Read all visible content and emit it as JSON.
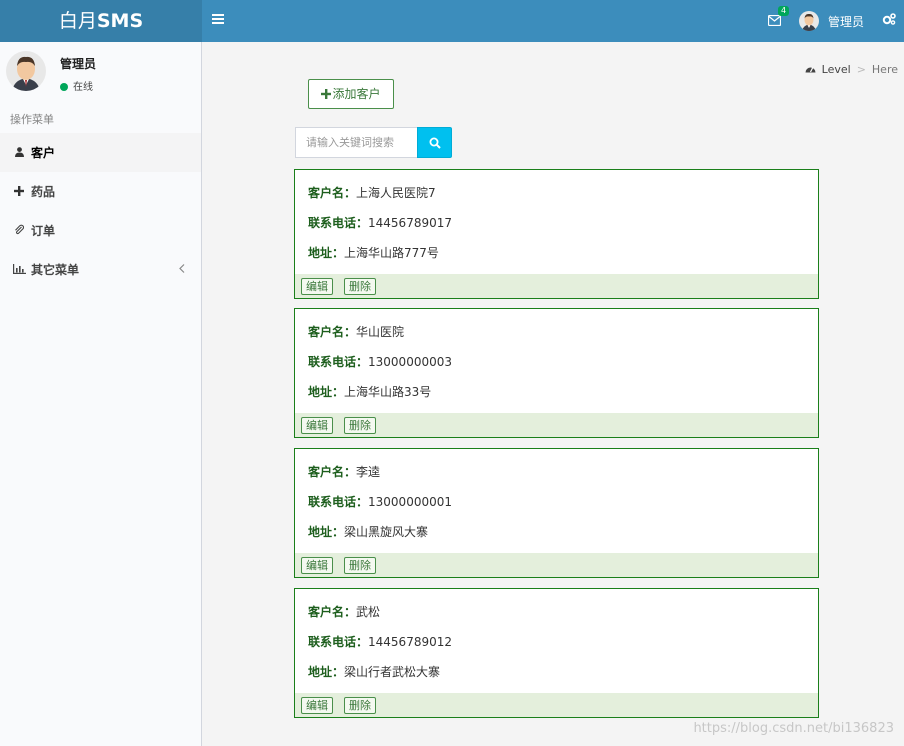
{
  "header": {
    "logo_light": "白月",
    "logo_bold": "SMS",
    "mail_count": "4",
    "user_name": "管理员"
  },
  "sidebar": {
    "user_name": "管理员",
    "status": "在线",
    "menu_header": "操作菜单",
    "items": [
      {
        "label": "客户",
        "icon": "user-icon"
      },
      {
        "label": "药品",
        "icon": "plus-icon"
      },
      {
        "label": "订单",
        "icon": "paperclip-icon"
      },
      {
        "label": "其它菜单",
        "icon": "bar-chart-icon"
      }
    ]
  },
  "breadcrumb": {
    "level": "Level",
    "separator": ">",
    "here": "Here"
  },
  "toolbar": {
    "add_label": "添加客户"
  },
  "search": {
    "placeholder": "请输入关键词搜索"
  },
  "labels": {
    "name": "客户名：",
    "phone": "联系电话：",
    "address": "地址：",
    "edit": "编辑",
    "delete": "删除"
  },
  "customers": [
    {
      "name": "上海人民医院7",
      "phone": "14456789017",
      "address": "上海华山路777号"
    },
    {
      "name": "华山医院",
      "phone": "13000000003",
      "address": "上海华山路33号"
    },
    {
      "name": "李逵",
      "phone": "13000000001",
      "address": "梁山黑旋风大寨"
    },
    {
      "name": "武松",
      "phone": "14456789012",
      "address": "梁山行者武松大寨"
    }
  ],
  "watermark": "https://blog.csdn.net/bi136823",
  "colors": {
    "header": "#3c8dbc",
    "logo_bg": "#367fa9",
    "card_border": "#1a7f1a",
    "search_btn": "#00c0ef",
    "online": "#00a65a"
  }
}
